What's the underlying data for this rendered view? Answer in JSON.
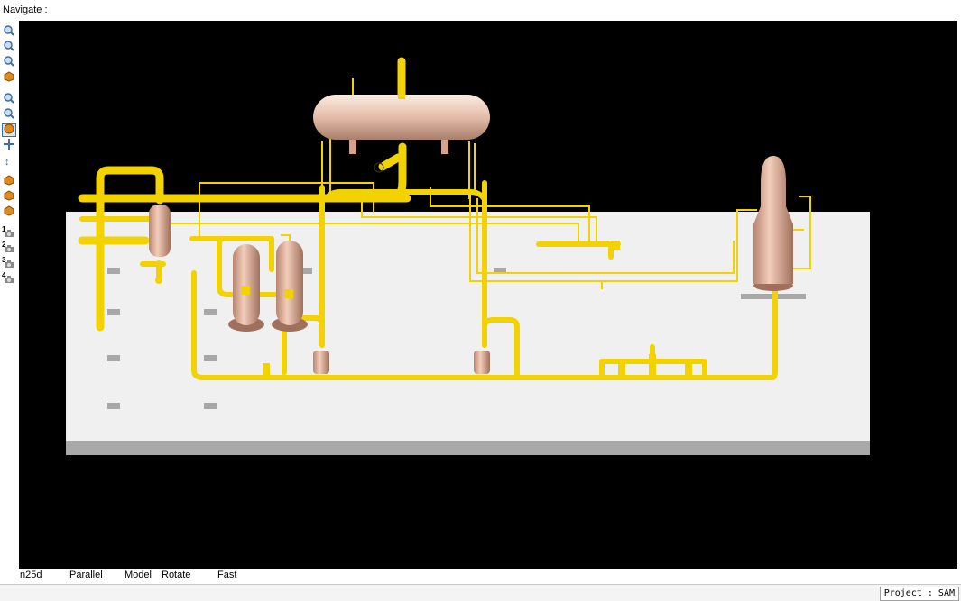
{
  "header": {
    "navigate_label": "Navigate :"
  },
  "toolbar": {
    "buttons": [
      {
        "icon": "zoom-extents-icon"
      },
      {
        "icon": "zoom-box-icon"
      },
      {
        "icon": "zoom-selected-icon"
      },
      {
        "icon": "view-cube-icon"
      },
      {
        "icon": "zoom-window-icon"
      },
      {
        "icon": "zoom-icon"
      },
      {
        "icon": "rotate-icon",
        "active": true
      },
      {
        "icon": "pan-icon"
      },
      {
        "icon": "walk-icon"
      },
      {
        "icon": "view-up-icon"
      },
      {
        "icon": "view-iso-icon"
      },
      {
        "icon": "view-side-icon"
      },
      {
        "icon": "camera-1-icon",
        "num": "1"
      },
      {
        "icon": "camera-2-icon",
        "num": "2"
      },
      {
        "icon": "camera-3-icon",
        "num": "3"
      },
      {
        "icon": "camera-4-icon",
        "num": "4"
      }
    ]
  },
  "status": {
    "view_mode": "n25d",
    "projection": "Parallel",
    "model_label": "Model",
    "action": "Rotate",
    "speed": "Fast"
  },
  "footer": {
    "project": "Project : SAM"
  },
  "colors": {
    "viewport_bg": "#000000",
    "pipe": "#f2d200",
    "vessel": "#e8b8a3",
    "slab": "#f0f0f0"
  }
}
